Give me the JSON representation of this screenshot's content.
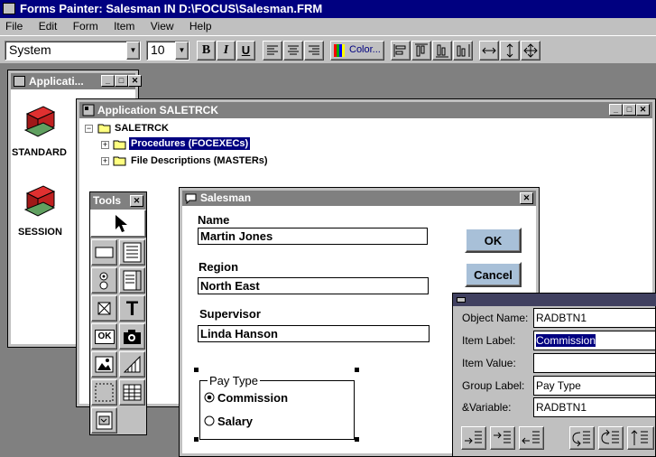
{
  "app": {
    "title": "Forms Painter: Salesman IN D:\\FOCUS\\Salesman.FRM"
  },
  "menu": [
    "File",
    "Edit",
    "Form",
    "Item",
    "View",
    "Help"
  ],
  "toolbar": {
    "font": "System",
    "size": "10",
    "bold": "B",
    "italic": "I",
    "underline": "U",
    "color_label": "Color..."
  },
  "app_window": {
    "title": "Applicati...",
    "icons": [
      {
        "label": "STANDARD",
        "icon": "filing-cabinet-icon"
      },
      {
        "label": "SESSION",
        "icon": "filing-cabinet-icon"
      }
    ]
  },
  "sale_window": {
    "title": "Application SALETRCK",
    "tree": {
      "root": "SALETRCK",
      "children": [
        "Procedures (FOCEXECs)",
        "File Descriptions (MASTERs)"
      ]
    }
  },
  "tools_window": {
    "title": "Tools",
    "ok_label": "OK",
    "t_label": "T"
  },
  "form": {
    "title": "Salesman",
    "fields": [
      {
        "label": "Name",
        "value": "Martin Jones"
      },
      {
        "label": "Region",
        "value": "North East"
      },
      {
        "label": "Supervisor",
        "value": "Linda Hanson"
      }
    ],
    "ok_button": "OK",
    "cancel_button": "Cancel",
    "group": {
      "label": "Pay Type",
      "options": [
        {
          "label": "Commission",
          "checked": true
        },
        {
          "label": "Salary",
          "checked": false
        }
      ]
    }
  },
  "properties": {
    "rows": [
      {
        "label": "Object Name:",
        "value": "RADBTN1"
      },
      {
        "label": "Item Label:",
        "value": "Commission"
      },
      {
        "label": "Item Value:",
        "value": ""
      },
      {
        "label": "Group Label:",
        "value": "Pay Type"
      },
      {
        "label": "&Variable:",
        "value": "RADBTN1"
      }
    ]
  },
  "colors": {
    "active_title": "#000080",
    "inactive_title": "#808080",
    "desktop": "#808080",
    "face": "#c0c0c0"
  }
}
